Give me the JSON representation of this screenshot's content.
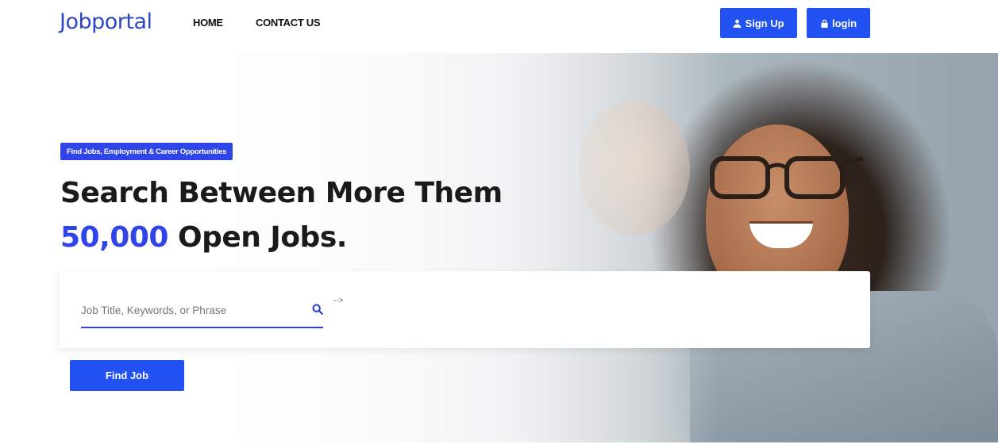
{
  "brand": "Jobportal",
  "nav": {
    "home": "HOME",
    "contact": "CONTACT US"
  },
  "auth": {
    "signup": "Sign Up",
    "login": "login"
  },
  "hero": {
    "badge": "Find Jobs, Employment & Career Opportunities",
    "headline_line1": "Search Between More Them",
    "headline_number": "50,000",
    "headline_rest": "Open Jobs."
  },
  "search": {
    "placeholder": "Job Title, Keywords, or Phrase",
    "stray_text": "-->",
    "button": "Find Job"
  },
  "colors": {
    "accent": "#2f45e8",
    "button": "#2352f2",
    "text": "#1a1a1a"
  }
}
